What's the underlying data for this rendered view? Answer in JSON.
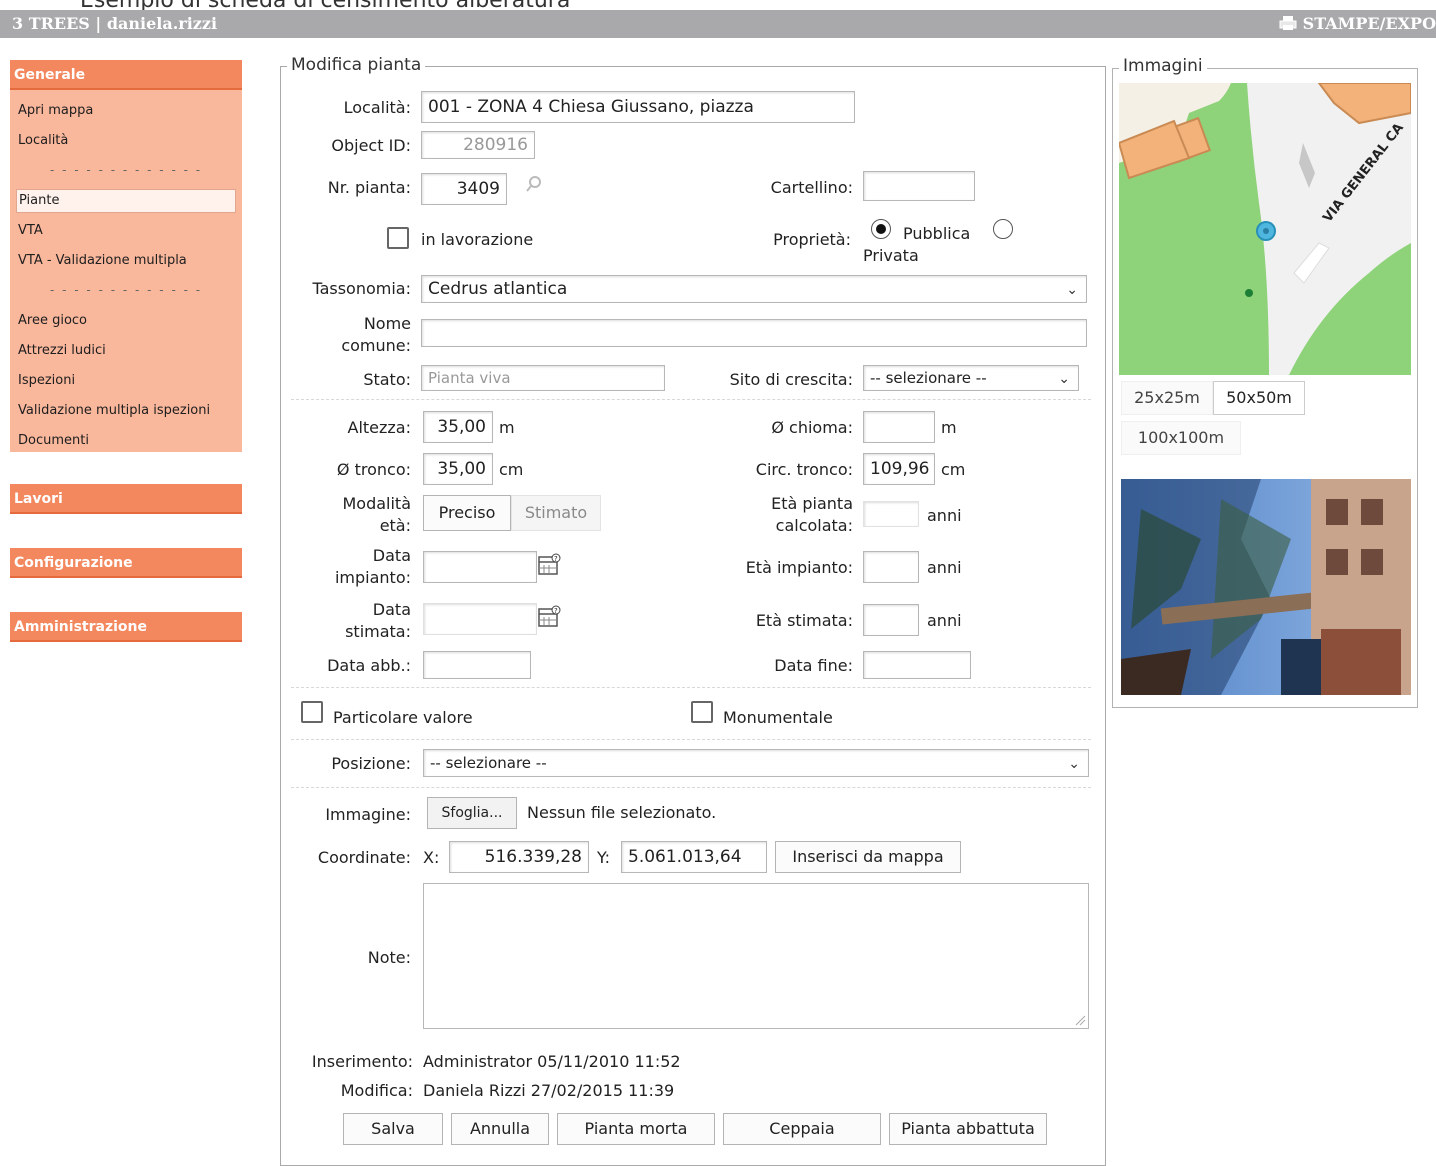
{
  "caption": "Esempio di scheda di censimento alberatura",
  "topbar": {
    "title": "3 TREES | daniela.rizzi",
    "print_label": "STAMPE/EXPO"
  },
  "sidebar": {
    "generale": "Generale",
    "items_top": [
      "Apri mappa",
      "Località"
    ],
    "separator": "- - - - - - - - - - - - -",
    "items_mid": [
      "Piante",
      "VTA",
      "VTA - Validazione multipla"
    ],
    "items_bottom": [
      "Aree gioco",
      "Attrezzi ludici",
      "Ispezioni",
      "Validazione multipla ispezioni",
      "Documenti"
    ],
    "lavori": "Lavori",
    "configurazione": "Configurazione",
    "amministrazione": "Amministrazione"
  },
  "form": {
    "legend": "Modifica pianta",
    "localita_label": "Località:",
    "localita_value": "001 - ZONA 4 Chiesa Giussano, piazza",
    "objectid_label": "Object ID:",
    "objectid_value": "280916",
    "nr_pianta_label": "Nr. pianta:",
    "nr_pianta_value": "3409",
    "cartellino_label": "Cartellino:",
    "cartellino_value": "",
    "in_lavorazione_label": "in lavorazione",
    "proprieta_label": "Proprietà:",
    "proprieta_pubblica": "Pubblica",
    "proprieta_privata": "Privata",
    "proprieta_selected": "Pubblica",
    "tassonomia_label": "Tassonomia:",
    "tassonomia_value": "Cedrus atlantica",
    "nome_comune_label_1": "Nome",
    "nome_comune_label_2": "comune:",
    "nome_comune_value": "",
    "stato_label": "Stato:",
    "stato_value": "Pianta viva",
    "sito_label": "Sito di crescita:",
    "sito_value": "-- selezionare --",
    "altezza_label": "Altezza:",
    "altezza_value": "35,00",
    "altezza_unit": "m",
    "chioma_label": "Ø chioma:",
    "chioma_value": "",
    "chioma_unit": "m",
    "tronco_label": "Ø tronco:",
    "tronco_value": "35,00",
    "tronco_unit": "cm",
    "circ_label": "Circ. tronco:",
    "circ_value": "109,96",
    "circ_unit": "cm",
    "modalita_label_1": "Modalità",
    "modalita_label_2": "età:",
    "modalita_preciso": "Preciso",
    "modalita_stimato": "Stimato",
    "eta_calc_label_1": "Età pianta",
    "eta_calc_label_2": "calcolata:",
    "eta_calc_unit": "anni",
    "data_impianto_label_1": "Data",
    "data_impianto_label_2": "impianto:",
    "eta_impianto_label": "Età impianto:",
    "eta_impianto_unit": "anni",
    "data_stimata_label_1": "Data",
    "data_stimata_label_2": "stimata:",
    "eta_stimata_label": "Età stimata:",
    "eta_stimata_unit": "anni",
    "data_abb_label": "Data abb.:",
    "data_fine_label": "Data fine:",
    "particolare_label": "Particolare valore",
    "monumentale_label": "Monumentale",
    "posizione_label": "Posizione:",
    "posizione_value": "-- selezionare --",
    "immagine_label": "Immagine:",
    "sfoglia_label": "Sfoglia...",
    "nessun_file": "Nessun file selezionato.",
    "coordinate_label": "Coordinate:",
    "x_label": "X:",
    "x_value": "516.339,28",
    "y_label": "Y:",
    "y_value": "5.061.013,64",
    "inserisci_label": "Inserisci da mappa",
    "note_label": "Note:",
    "inserimento_label": "Inserimento:",
    "inserimento_value": "Administrator 05/11/2010 11:52",
    "modifica_label": "Modifica:",
    "modifica_value": "Daniela Rizzi 27/02/2015 11:39",
    "btn_salva": "Salva",
    "btn_annulla": "Annulla",
    "btn_morta": "Pianta morta",
    "btn_ceppaia": "Ceppaia",
    "btn_abbattuta": "Pianta abbattuta"
  },
  "images": {
    "legend": "Immagini",
    "street_label": "VIA GENERAL CA",
    "scale_25": "25x25m",
    "scale_50": "50x50m",
    "scale_100": "100x100m"
  },
  "colors": {
    "menu_accent": "#f3875e",
    "menu_body": "#f9b79c",
    "topbar": "#a9a9ab",
    "map_green": "#8ed27a",
    "map_building": "#f2b27a"
  }
}
